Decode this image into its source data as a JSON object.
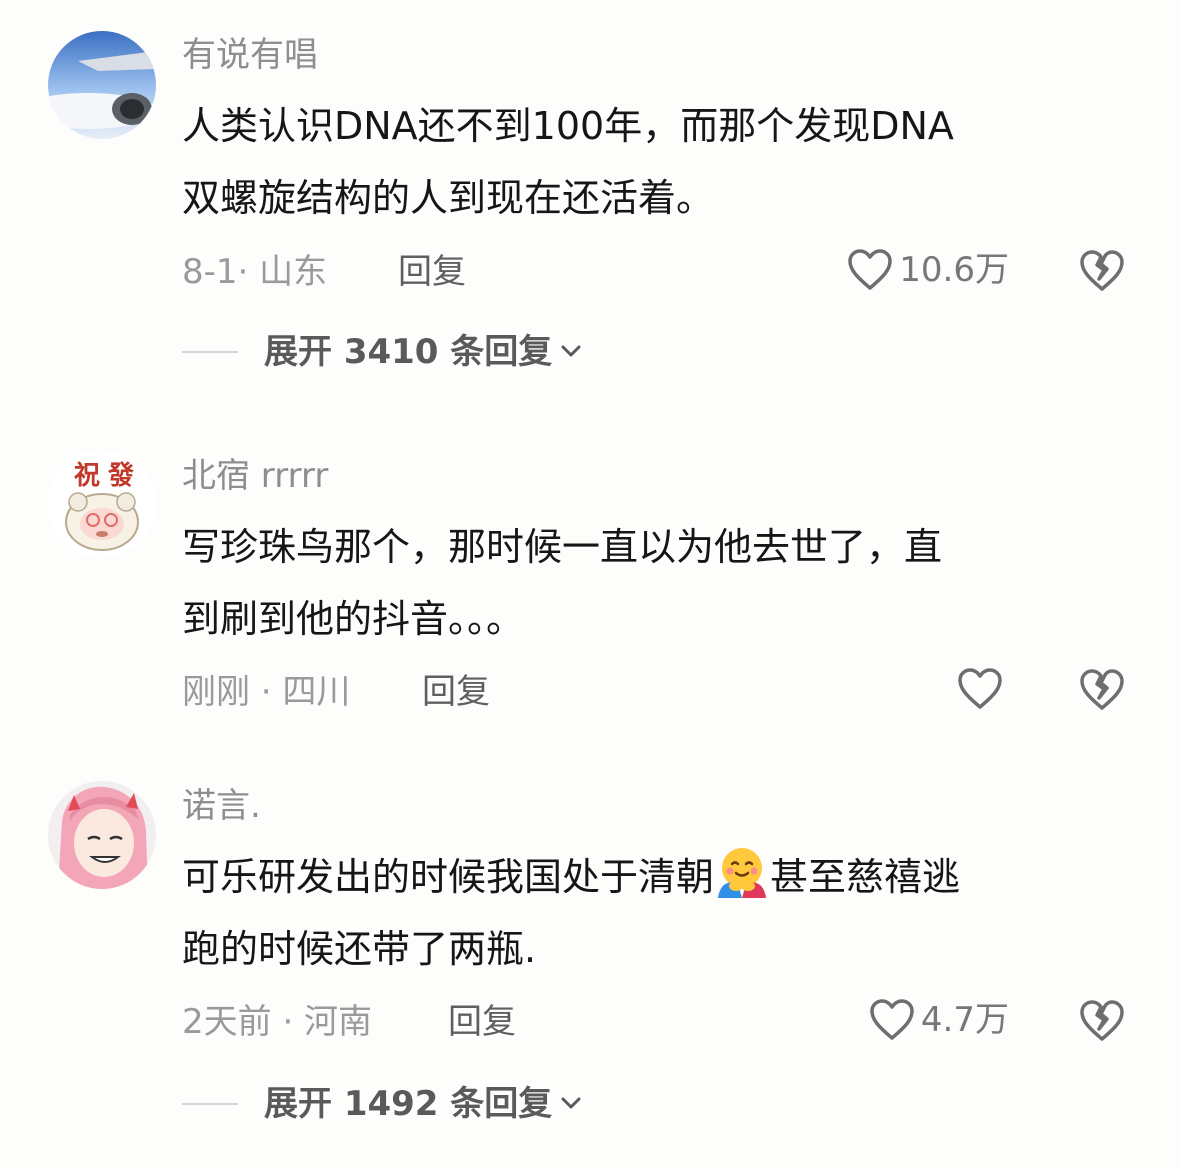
{
  "comments": [
    {
      "username": "有说有唱",
      "text_line1": "人类认识DNA还不到100年，而那个发现DNA",
      "text_line2": "双螺旋结构的人到现在还活着。",
      "meta": "8-1· 山东",
      "reply_label": "回复",
      "likes": "10.6万",
      "expand_label": "展开 3410 条回复"
    },
    {
      "username": "北宿 rrrrr",
      "text_line1": "写珍珠鸟那个，那时候一直以为他去世了，直",
      "text_line2": "到刷到他的抖音。。。",
      "meta": "刚刚 · 四川",
      "reply_label": "回复",
      "likes": ""
    },
    {
      "username": "诺言.",
      "text_line1_a": "可乐研发出的时候我国处于清朝",
      "text_line1_emoji": "hugging-face-emoji",
      "text_line1_b": "甚至慈禧逃",
      "text_line2": "跑的时候还带了两瓶.",
      "meta": "2天前 · 河南",
      "reply_label": "回复",
      "likes": "4.7万",
      "expand_label": "展开 1492 条回复"
    }
  ],
  "icons": {
    "like": "heart-outline-icon",
    "dislike": "broken-heart-icon",
    "expand": "chevron-down-icon"
  },
  "colors": {
    "background": "#fdfdfc",
    "username": "#8e8e8e",
    "text": "#161616",
    "meta": "#9a9a9a"
  }
}
